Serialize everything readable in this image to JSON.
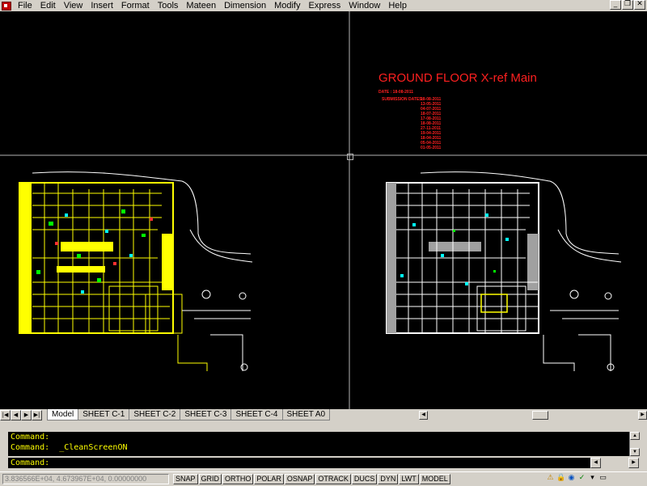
{
  "menubar": {
    "items": [
      "File",
      "Edit",
      "View",
      "Insert",
      "Format",
      "Tools",
      "Mateen",
      "Dimension",
      "Modify",
      "Express",
      "Window",
      "Help"
    ]
  },
  "window_controls": [
    "minimize-icon",
    "restore-icon",
    "close-icon"
  ],
  "drawing": {
    "title": "GROUND FLOOR X-ref Main",
    "date_label": "DATE : 18-08-2011",
    "submission_label": "SUBMISSION DATES:",
    "dates": [
      "18-08-2011",
      "13-05-2011",
      "04-07-2011",
      "18-07-2011",
      "17-08-2011",
      "18-08-2011",
      "27-11-2011",
      "19-04-2011",
      "18-04-2011",
      "05-04-2011",
      "01-05-2011"
    ],
    "colors": {
      "background": "#000000",
      "left_plan": "#ffff00",
      "right_plan": "#ffffff",
      "annotation": "#ff2020"
    }
  },
  "layout_tabs": {
    "nav_icons": [
      "first-tab-icon",
      "prev-tab-icon",
      "next-tab-icon",
      "last-tab-icon"
    ],
    "tabs": [
      "Model",
      "SHEET C-1",
      "SHEET C-2",
      "SHEET C-3",
      "SHEET C-4",
      "SHEET A0"
    ],
    "active": "Model"
  },
  "command": {
    "history": [
      "Command:",
      "Command:  _CleanScreenON"
    ],
    "prompt": "Command:"
  },
  "statusbar": {
    "coordinates": "3.836566E+04, 4.673967E+04, 0.00000000",
    "toggles": [
      "SNAP",
      "GRID",
      "ORTHO",
      "POLAR",
      "OSNAP",
      "OTRACK",
      "DUCS",
      "DYN",
      "LWT",
      "MODEL"
    ],
    "tray_icons": [
      "comm-center-icon",
      "lock-icon",
      "comm-icon",
      "qc-icon",
      "update-icon",
      "clean-screen-icon"
    ]
  }
}
